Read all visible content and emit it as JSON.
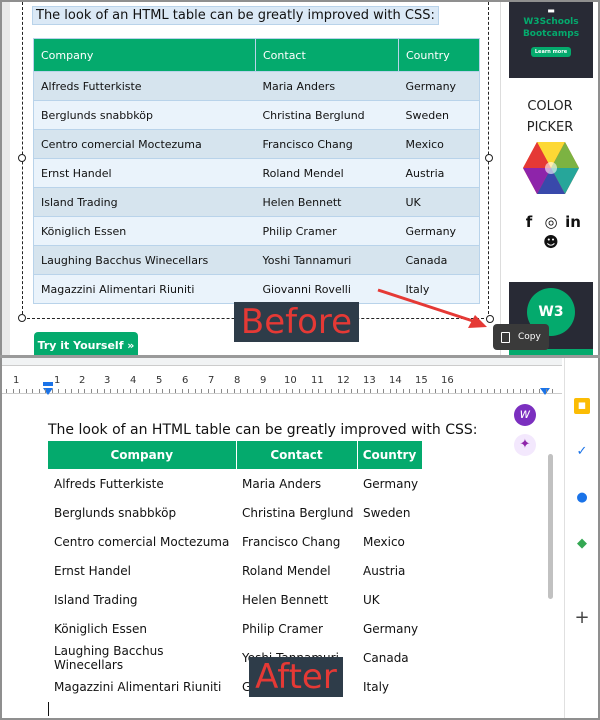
{
  "before": {
    "intro": "The look of an HTML table can be greatly improved with CSS:",
    "headers": [
      "Company",
      "Contact",
      "Country"
    ],
    "rows": [
      [
        "Alfreds Futterkiste",
        "Maria Anders",
        "Germany"
      ],
      [
        "Berglunds snabbköp",
        "Christina Berglund",
        "Sweden"
      ],
      [
        "Centro comercial Moctezuma",
        "Francisco Chang",
        "Mexico"
      ],
      [
        "Ernst Handel",
        "Roland Mendel",
        "Austria"
      ],
      [
        "Island Trading",
        "Helen Bennett",
        "UK"
      ],
      [
        "Königlich Essen",
        "Philip Cramer",
        "Germany"
      ],
      [
        "Laughing Bacchus Winecellars",
        "Yoshi Tannamuri",
        "Canada"
      ],
      [
        "Magazzini Alimentari Riuniti",
        "Giovanni Rovelli",
        "Italy"
      ]
    ],
    "try_button": "Try it Yourself »",
    "copy_label": "Copy",
    "label": "Before",
    "sidebar": {
      "ad_lines": [
        "W3Schools",
        "Bootcamps"
      ],
      "ad_button": "Learn more",
      "picker_line1": "COLOR",
      "picker_line2": "PICKER",
      "badge_text": "W3"
    }
  },
  "after": {
    "intro": "The look of an HTML table can be greatly improved with CSS:",
    "headers": [
      "Company",
      "Contact",
      "Country"
    ],
    "rows": [
      [
        "Alfreds Futterkiste",
        "Maria Anders",
        "Germany"
      ],
      [
        "Berglunds snabbköp",
        "Christina Berglund",
        "Sweden"
      ],
      [
        "Centro comercial Moctezuma",
        "Francisco Chang",
        "Mexico"
      ],
      [
        "Ernst Handel",
        "Roland Mendel",
        "Austria"
      ],
      [
        "Island Trading",
        "Helen Bennett",
        "UK"
      ],
      [
        "Königlich Essen",
        "Philip Cramer",
        "Germany"
      ],
      [
        "Laughing Bacchus Winecellars",
        "Yoshi Tannamuri",
        "Canada"
      ],
      [
        "Magazzini Alimentari Riuniti",
        "Giovanni Rovelli",
        "Italy"
      ]
    ],
    "label": "After",
    "ruler_numbers": [
      "1",
      "1",
      "2",
      "3",
      "4",
      "5",
      "6",
      "7",
      "8",
      "9",
      "10",
      "11",
      "12",
      "13",
      "14",
      "15",
      "16"
    ]
  },
  "colors": {
    "accent": "#04aa6d",
    "label_bg": "#2e3c49",
    "label_text": "#e53935",
    "row_odd": "#d6e4ee",
    "row_even": "#eaf3fb"
  }
}
